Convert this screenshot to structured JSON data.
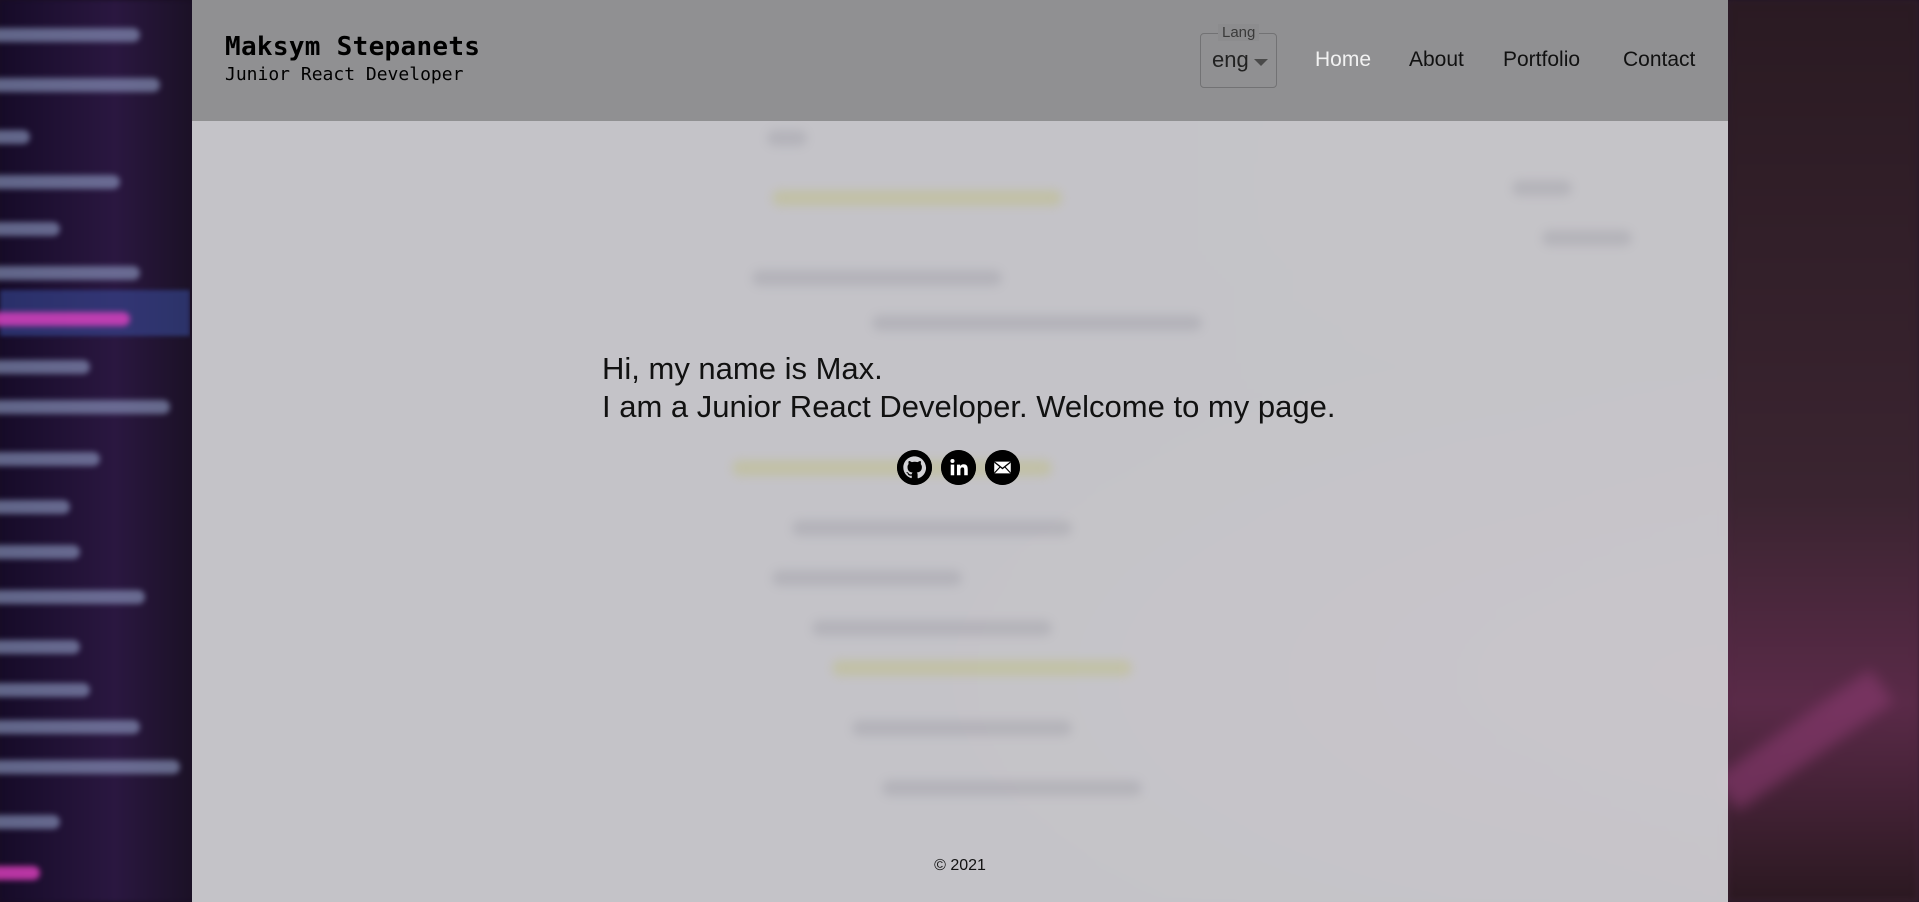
{
  "header": {
    "brand_name": "Maksym Stepanets",
    "brand_role": "Junior React Developer"
  },
  "language": {
    "label": "Lang",
    "selected": "eng"
  },
  "nav": {
    "items": [
      {
        "label": "Home",
        "active": true
      },
      {
        "label": "About",
        "active": false
      },
      {
        "label": "Portfolio",
        "active": false
      },
      {
        "label": "Contact",
        "active": false
      }
    ]
  },
  "hero": {
    "greeting": "Hi, my name is Max.",
    "intro": "I am a Junior React Developer. Welcome to my page."
  },
  "socials": [
    {
      "icon": "github-icon"
    },
    {
      "icon": "linkedin-icon"
    },
    {
      "icon": "email-icon"
    }
  ],
  "footer": {
    "copyright": "© 2021"
  },
  "colors": {
    "header_bg": "#8c8c8e",
    "panel_bg": "#d2d2d6",
    "nav_active": "#f2f2f2",
    "text": "#111111"
  }
}
